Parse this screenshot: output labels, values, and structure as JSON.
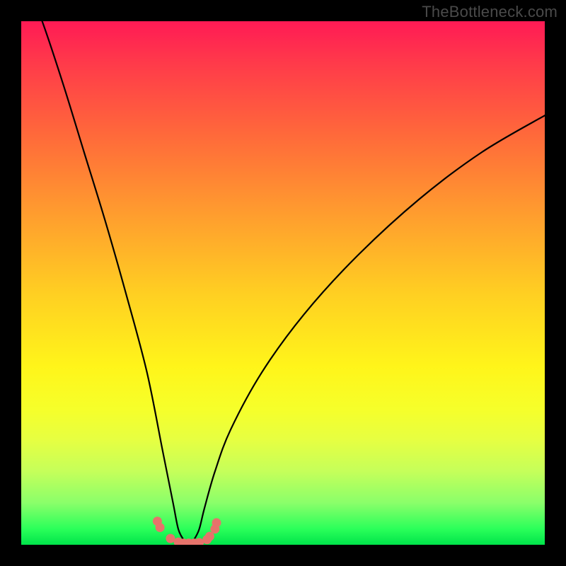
{
  "watermark": {
    "text": "TheBottleneck.com"
  },
  "chart_data": {
    "type": "line",
    "title": "",
    "xlabel": "",
    "ylabel": "",
    "xlim": [
      0,
      100
    ],
    "ylim": [
      0,
      100
    ],
    "notes": "Bottleneck curve: dips to ~0 at the no-bottleneck point around x≈32, rises steeply toward both sides. Background gradient encodes bottleneck severity (red high → green low).",
    "series": [
      {
        "name": "bottleneck-curve",
        "x": [
          0,
          4,
          8,
          12,
          16,
          20,
          24,
          27,
          29,
          30,
          31,
          32,
          33,
          34,
          35,
          37,
          40,
          46,
          54,
          64,
          76,
          88,
          100
        ],
        "y": [
          110,
          100,
          88,
          75,
          62,
          48,
          33,
          18,
          8,
          3,
          1,
          0,
          1,
          3,
          7,
          14,
          22,
          33,
          44,
          55,
          66,
          75,
          82
        ]
      }
    ],
    "markers": {
      "name": "bottom-dots",
      "color": "#e6736b",
      "x": [
        26,
        26.5,
        28.5,
        30,
        31,
        32,
        33,
        34,
        35.5,
        36,
        37,
        37.3
      ],
      "y": [
        4.5,
        3.3,
        1.2,
        0.5,
        0.3,
        0.3,
        0.3,
        0.4,
        1.0,
        1.6,
        3.0,
        4.2
      ]
    },
    "gradient_stops": [
      {
        "pos": 0.0,
        "color": "#ff1a55"
      },
      {
        "pos": 0.5,
        "color": "#fff51a"
      },
      {
        "pos": 0.95,
        "color": "#2aff5a"
      },
      {
        "pos": 1.0,
        "color": "#00e44a"
      }
    ]
  }
}
